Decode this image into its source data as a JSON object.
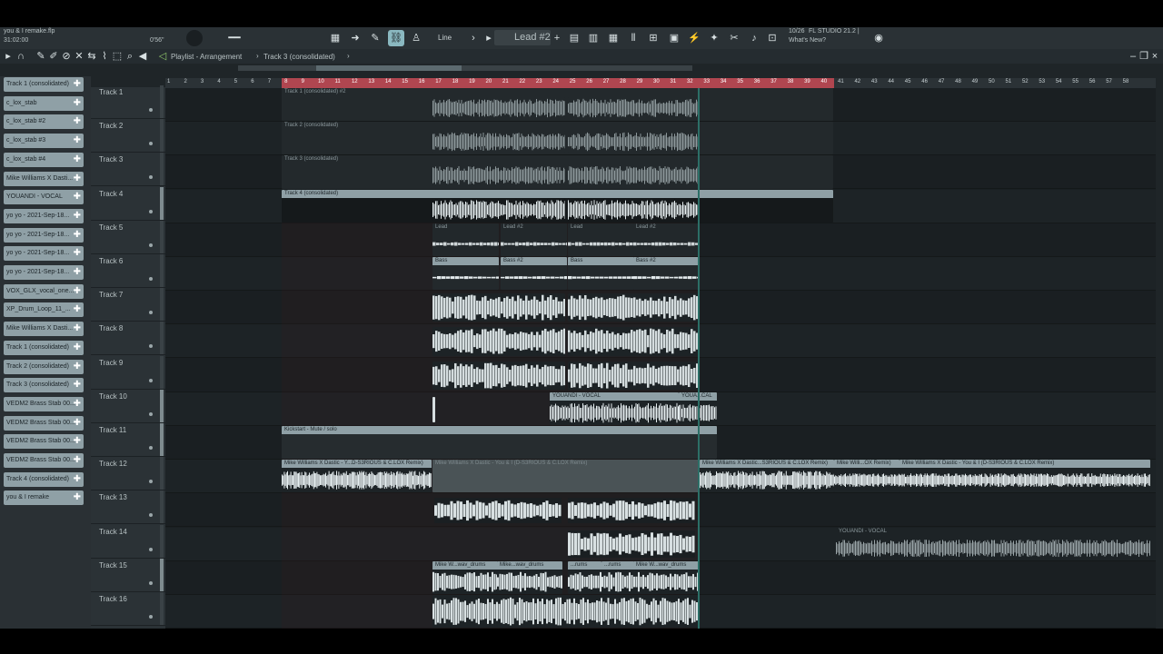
{
  "titlebar": {
    "project": "you & I remake.flp",
    "time": "31:02:00",
    "version": "FL STUDIO 21.2 |",
    "news_count": "10/26",
    "news": "What's New?",
    "tempo_readout": "0'56\""
  },
  "toolbar": {
    "pattern": "Lead #2",
    "snap": "Line"
  },
  "breadcrumb": {
    "view": "Playlist - Arrangement",
    "sep": "›",
    "track": "Track 3 (consolidated)",
    "end": "›"
  },
  "browser": {
    "items": [
      "Track 1 (consolidated)",
      "c_lox_stab",
      "c_lox_stab #2",
      "c_lox_stab #3",
      "c_lox_stab #4",
      "Mike Williams X Dasti...",
      "YOUANDI - VOCAL",
      "yo yo - 2021-Sep-18...",
      "yo yo - 2021-Sep-18...",
      "yo yo - 2021-Sep-18...",
      "yo yo - 2021-Sep-18...",
      "VOX_GLX_vocal_one...",
      "XP_Drum_Loop_11_...",
      "Mike Williams X Dasti...",
      "Track 1 (consolidated)",
      "Track 2 (consolidated)",
      "Track 3 (consolidated)",
      "VEDM2 Brass Stab 00...",
      "VEDM2 Brass Stab 00...",
      "VEDM2 Brass Stab 00...",
      "VEDM2 Brass Stab 00...",
      "Track 4 (consolidated)",
      "you & I remake"
    ]
  },
  "tracks": [
    "Track 1",
    "Track 2",
    "Track 3",
    "Track 4",
    "Track 5",
    "Track 6",
    "Track 7",
    "Track 8",
    "Track 9",
    "Track 10",
    "Track 11",
    "Track 12",
    "Track 13",
    "Track 14",
    "Track 15",
    "Track 16"
  ],
  "ruler": [
    "1",
    "2",
    "3",
    "4",
    "5",
    "6",
    "7",
    "8",
    "9",
    "10",
    "11",
    "12",
    "13",
    "14",
    "15",
    "16",
    "17",
    "18",
    "19",
    "20",
    "21",
    "22",
    "23",
    "24",
    "25",
    "26",
    "27",
    "28",
    "29",
    "30",
    "31",
    "32",
    "33",
    "34",
    "35",
    "36",
    "37",
    "38",
    "39",
    "40",
    "41",
    "42",
    "43",
    "44",
    "45",
    "46",
    "47",
    "48",
    "49",
    "50",
    "51",
    "52",
    "53",
    "54",
    "55",
    "56",
    "57",
    "58"
  ],
  "clips": {
    "t1": "Track 1 (consolidated) #2",
    "t2": "Track 2 (consolidated)",
    "t3": "Track 3 (consolidated)",
    "t4": "Track 4 (consolidated)",
    "lead": "Lead",
    "lead2": "Lead #2",
    "bass": "Bass",
    "bass2": "Bass #2",
    "vocal": "YOUANDI - VOCAL",
    "vocal_short": "YOUA...CAL",
    "kick": "Kickstart - Mute / solo",
    "mw1": "Mike Williams X Dastic - Y...D-S3RIOUS & C.LOX Remix)",
    "mw2": "Mike Williams X Dastic - You & I (D-S3RIOUS & C.LOX Remix)",
    "mw3": "Mike Williams X Dastic...S3RIOUS & C.LOX Remix)",
    "mw4": "Mike Willi...OX Remix)",
    "mw5": "Mike Williams X Dastic - You & I (D-S3RIOUS & C.LOX Remix)",
    "drums1": "Mike W...wav_drums",
    "drums2": "Mike...wav_drums",
    "drums3": "...rums",
    "drums4": "...rums",
    "drums5": "Mike W...wav_drums"
  },
  "colors": {
    "loop": "#b04650",
    "clip_bg": "#2e3538",
    "clip_title": "#8a979b",
    "audio_light": "#e6eef0",
    "audio_mid": "#9aa5a8"
  }
}
